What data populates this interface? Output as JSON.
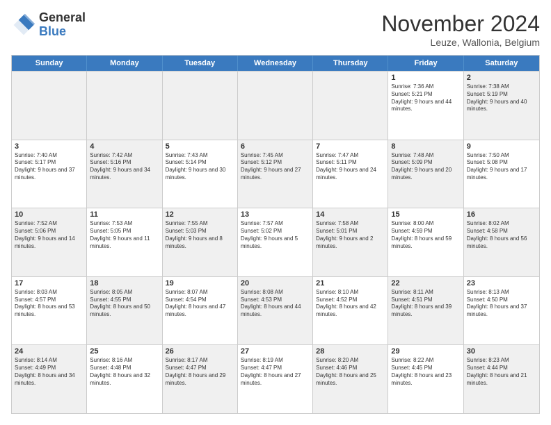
{
  "logo": {
    "general": "General",
    "blue": "Blue"
  },
  "header": {
    "month": "November 2024",
    "location": "Leuze, Wallonia, Belgium"
  },
  "weekdays": [
    "Sunday",
    "Monday",
    "Tuesday",
    "Wednesday",
    "Thursday",
    "Friday",
    "Saturday"
  ],
  "rows": [
    [
      {
        "day": "",
        "info": "",
        "shaded": true
      },
      {
        "day": "",
        "info": "",
        "shaded": true
      },
      {
        "day": "",
        "info": "",
        "shaded": true
      },
      {
        "day": "",
        "info": "",
        "shaded": true
      },
      {
        "day": "",
        "info": "",
        "shaded": true
      },
      {
        "day": "1",
        "info": "Sunrise: 7:36 AM\nSunset: 5:21 PM\nDaylight: 9 hours and 44 minutes.",
        "shaded": false
      },
      {
        "day": "2",
        "info": "Sunrise: 7:38 AM\nSunset: 5:19 PM\nDaylight: 9 hours and 40 minutes.",
        "shaded": true
      }
    ],
    [
      {
        "day": "3",
        "info": "Sunrise: 7:40 AM\nSunset: 5:17 PM\nDaylight: 9 hours and 37 minutes.",
        "shaded": false
      },
      {
        "day": "4",
        "info": "Sunrise: 7:42 AM\nSunset: 5:16 PM\nDaylight: 9 hours and 34 minutes.",
        "shaded": true
      },
      {
        "day": "5",
        "info": "Sunrise: 7:43 AM\nSunset: 5:14 PM\nDaylight: 9 hours and 30 minutes.",
        "shaded": false
      },
      {
        "day": "6",
        "info": "Sunrise: 7:45 AM\nSunset: 5:12 PM\nDaylight: 9 hours and 27 minutes.",
        "shaded": true
      },
      {
        "day": "7",
        "info": "Sunrise: 7:47 AM\nSunset: 5:11 PM\nDaylight: 9 hours and 24 minutes.",
        "shaded": false
      },
      {
        "day": "8",
        "info": "Sunrise: 7:48 AM\nSunset: 5:09 PM\nDaylight: 9 hours and 20 minutes.",
        "shaded": true
      },
      {
        "day": "9",
        "info": "Sunrise: 7:50 AM\nSunset: 5:08 PM\nDaylight: 9 hours and 17 minutes.",
        "shaded": false
      }
    ],
    [
      {
        "day": "10",
        "info": "Sunrise: 7:52 AM\nSunset: 5:06 PM\nDaylight: 9 hours and 14 minutes.",
        "shaded": true
      },
      {
        "day": "11",
        "info": "Sunrise: 7:53 AM\nSunset: 5:05 PM\nDaylight: 9 hours and 11 minutes.",
        "shaded": false
      },
      {
        "day": "12",
        "info": "Sunrise: 7:55 AM\nSunset: 5:03 PM\nDaylight: 9 hours and 8 minutes.",
        "shaded": true
      },
      {
        "day": "13",
        "info": "Sunrise: 7:57 AM\nSunset: 5:02 PM\nDaylight: 9 hours and 5 minutes.",
        "shaded": false
      },
      {
        "day": "14",
        "info": "Sunrise: 7:58 AM\nSunset: 5:01 PM\nDaylight: 9 hours and 2 minutes.",
        "shaded": true
      },
      {
        "day": "15",
        "info": "Sunrise: 8:00 AM\nSunset: 4:59 PM\nDaylight: 8 hours and 59 minutes.",
        "shaded": false
      },
      {
        "day": "16",
        "info": "Sunrise: 8:02 AM\nSunset: 4:58 PM\nDaylight: 8 hours and 56 minutes.",
        "shaded": true
      }
    ],
    [
      {
        "day": "17",
        "info": "Sunrise: 8:03 AM\nSunset: 4:57 PM\nDaylight: 8 hours and 53 minutes.",
        "shaded": false
      },
      {
        "day": "18",
        "info": "Sunrise: 8:05 AM\nSunset: 4:55 PM\nDaylight: 8 hours and 50 minutes.",
        "shaded": true
      },
      {
        "day": "19",
        "info": "Sunrise: 8:07 AM\nSunset: 4:54 PM\nDaylight: 8 hours and 47 minutes.",
        "shaded": false
      },
      {
        "day": "20",
        "info": "Sunrise: 8:08 AM\nSunset: 4:53 PM\nDaylight: 8 hours and 44 minutes.",
        "shaded": true
      },
      {
        "day": "21",
        "info": "Sunrise: 8:10 AM\nSunset: 4:52 PM\nDaylight: 8 hours and 42 minutes.",
        "shaded": false
      },
      {
        "day": "22",
        "info": "Sunrise: 8:11 AM\nSunset: 4:51 PM\nDaylight: 8 hours and 39 minutes.",
        "shaded": true
      },
      {
        "day": "23",
        "info": "Sunrise: 8:13 AM\nSunset: 4:50 PM\nDaylight: 8 hours and 37 minutes.",
        "shaded": false
      }
    ],
    [
      {
        "day": "24",
        "info": "Sunrise: 8:14 AM\nSunset: 4:49 PM\nDaylight: 8 hours and 34 minutes.",
        "shaded": true
      },
      {
        "day": "25",
        "info": "Sunrise: 8:16 AM\nSunset: 4:48 PM\nDaylight: 8 hours and 32 minutes.",
        "shaded": false
      },
      {
        "day": "26",
        "info": "Sunrise: 8:17 AM\nSunset: 4:47 PM\nDaylight: 8 hours and 29 minutes.",
        "shaded": true
      },
      {
        "day": "27",
        "info": "Sunrise: 8:19 AM\nSunset: 4:47 PM\nDaylight: 8 hours and 27 minutes.",
        "shaded": false
      },
      {
        "day": "28",
        "info": "Sunrise: 8:20 AM\nSunset: 4:46 PM\nDaylight: 8 hours and 25 minutes.",
        "shaded": true
      },
      {
        "day": "29",
        "info": "Sunrise: 8:22 AM\nSunset: 4:45 PM\nDaylight: 8 hours and 23 minutes.",
        "shaded": false
      },
      {
        "day": "30",
        "info": "Sunrise: 8:23 AM\nSunset: 4:44 PM\nDaylight: 8 hours and 21 minutes.",
        "shaded": true
      }
    ]
  ]
}
